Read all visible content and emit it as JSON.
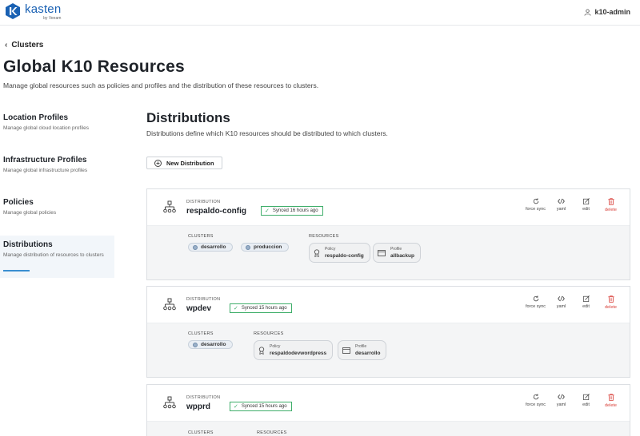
{
  "app": {
    "brand": "kasten",
    "brand_sub": "by Veeam",
    "user": "k10-admin",
    "icons": {
      "logo": "kasten-logo-icon",
      "user": "user-icon"
    },
    "accent": "#1a61b3"
  },
  "header": {
    "back_label": "Clusters",
    "title": "Global K10 Resources",
    "subtitle": "Manage global resources such as policies and profiles and the distribution of these resources to clusters."
  },
  "sidebar": {
    "items": [
      {
        "title": "Location Profiles",
        "desc": "Manage global cloud location profiles"
      },
      {
        "title": "Infrastructure Profiles",
        "desc": "Manage global infrastructure profiles"
      },
      {
        "title": "Policies",
        "desc": "Manage global policies"
      },
      {
        "title": "Distributions",
        "desc": "Manage distribution of resources to clusters"
      }
    ],
    "active": "Distributions"
  },
  "main": {
    "title": "Distributions",
    "description": "Distributions define which K10 resources should be distributed to which clusters.",
    "new_button": "New Distribution",
    "actions": {
      "force_sync": "force sync",
      "yaml": "yaml",
      "edit": "edit",
      "delete": "delete"
    },
    "labels": {
      "distribution": "DISTRIBUTION",
      "clusters": "CLUSTERS",
      "resources": "RESOURCES"
    },
    "sync_color": "#3fae6a",
    "delete_color": "#d9403a",
    "distributions": [
      {
        "name": "respaldo-config",
        "status": "Synced 16 hours ago",
        "clusters": [
          "desarrollo",
          "produccion"
        ],
        "resources": [
          {
            "kind": "Policy",
            "name": "respaldo-config"
          },
          {
            "kind": "Profile",
            "name": "allbackup"
          }
        ]
      },
      {
        "name": "wpdev",
        "status": "Synced 15 hours ago",
        "clusters": [
          "desarrollo"
        ],
        "resources": [
          {
            "kind": "Policy",
            "name": "respaldodevwordpress"
          },
          {
            "kind": "Profile",
            "name": "desarrollo"
          }
        ]
      },
      {
        "name": "wpprd",
        "status": "Synced 15 hours ago"
      }
    ]
  }
}
